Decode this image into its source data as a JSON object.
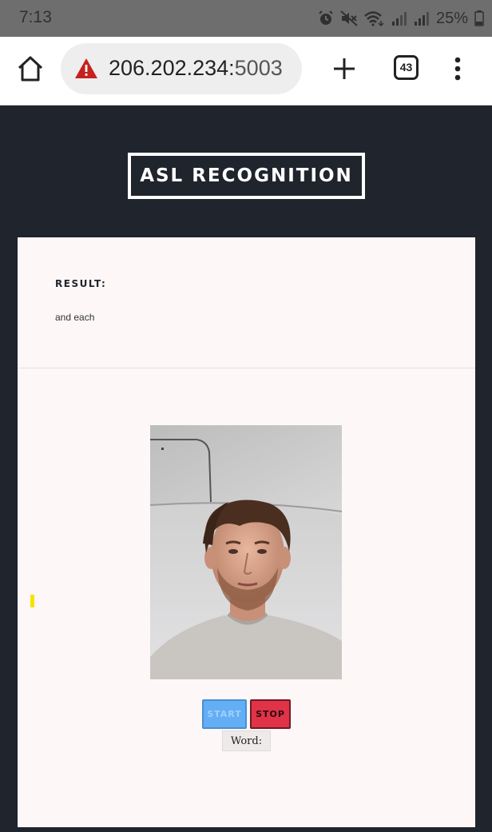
{
  "status_bar": {
    "time": "7:13",
    "battery": "25%",
    "icons": [
      "alarm-icon",
      "mute-icon",
      "wifi-icon",
      "signal-icon",
      "signal-icon",
      "battery-icon"
    ]
  },
  "browser": {
    "url_host": "206.202.234:",
    "url_port": "5003",
    "tab_count": "43",
    "icons": [
      "home-icon",
      "warning-icon",
      "plus-icon",
      "tabs-icon",
      "menu-icon"
    ]
  },
  "page": {
    "title": "ASL RECOGNITION",
    "result_label": "RESULT:",
    "result_value": "and each",
    "start_label": "START",
    "stop_label": "STOP",
    "word_label": "Word:"
  },
  "colors": {
    "page_background": "#1f242d",
    "card_background": "#fdf7f7",
    "start_button": "#63aef4",
    "stop_button": "#e03348",
    "warning": "#c5221f"
  }
}
